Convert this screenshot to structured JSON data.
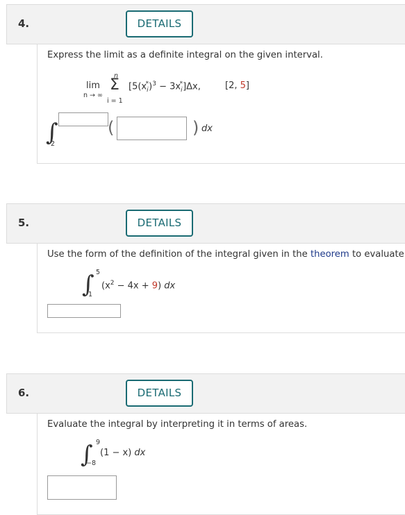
{
  "q4": {
    "number": "4.",
    "details": "DETAILS",
    "prompt": "Express the limit as a definite integral on the given interval.",
    "lim": "lim",
    "lim_sub": "n → ∞",
    "sum_top": "n",
    "sum_bottom": "i = 1",
    "sigma": "Σ",
    "expr_a": "[5(x",
    "expr_i1": "i",
    "expr_star1": "*",
    "expr_b": ")",
    "expr_pow": "3",
    "expr_c": " − 3x",
    "expr_i2": "i",
    "expr_star2": "*",
    "expr_d": "]Δx,",
    "interval_open": "[2, ",
    "interval_hi": "5",
    "interval_close": "]",
    "int_lower": "2",
    "dx": "dx",
    "lparen": "(",
    "rparen": ")"
  },
  "q5": {
    "number": "5.",
    "details": "DETAILS",
    "prompt_a": "Use the form of the definition of the integral given in the ",
    "prompt_link": "theorem",
    "prompt_b": " to evaluate t",
    "upper": "5",
    "lower": "1",
    "expr_a": "(x",
    "expr_pow": "2",
    "expr_b": " − 4x + ",
    "expr_c": "9",
    "expr_d": ")",
    "dx": " dx"
  },
  "q6": {
    "number": "6.",
    "details": "DETAILS",
    "prompt": "Evaluate the integral by interpreting it in terms of areas.",
    "upper": "9",
    "lower": "−8",
    "expr": "(1 − x)",
    "dx": " dx"
  },
  "colors": {
    "accent": "#1a6b73",
    "limit_red": "#c0392b",
    "link": "#1f3a8a"
  }
}
